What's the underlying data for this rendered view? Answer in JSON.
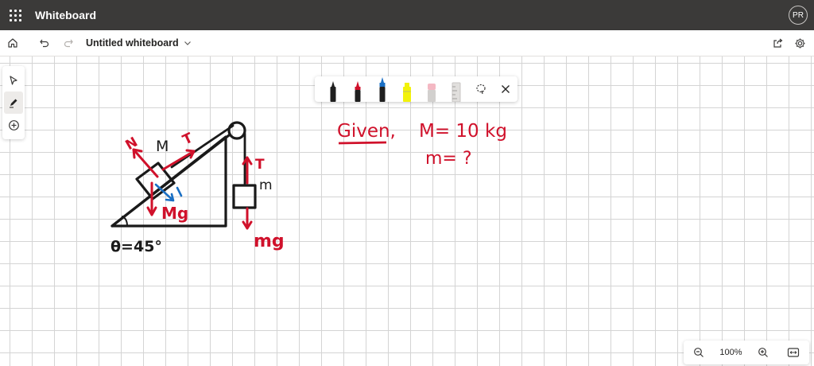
{
  "app": {
    "title": "Whiteboard",
    "user_initials": "PR"
  },
  "document": {
    "title": "Untitled whiteboard"
  },
  "ink_toolbar": {
    "pens": [
      {
        "name": "black-pen",
        "color": "#1f1f1f"
      },
      {
        "name": "red-pen",
        "color": "#d0112b"
      },
      {
        "name": "blue-pen",
        "color": "#1a6fc4"
      },
      {
        "name": "yellow-highlighter",
        "color": "#f2f20a"
      },
      {
        "name": "pink-eraser",
        "color": "#f4b8c3"
      },
      {
        "name": "ruler",
        "color": "#c8c6c4"
      }
    ],
    "icons": [
      "lasso-select-icon",
      "close-icon"
    ]
  },
  "zoom": {
    "level": "100%"
  },
  "drawing": {
    "ink_colors": {
      "black": "#1a1a1a",
      "red": "#d0112b",
      "blue": "#1a6fc4"
    },
    "handwritten_labels": [
      "N",
      "M",
      "T",
      "Mg",
      "θ=45°",
      "T",
      "m",
      "mg",
      "Given,",
      "M= 10 kg",
      "m= ?"
    ]
  }
}
